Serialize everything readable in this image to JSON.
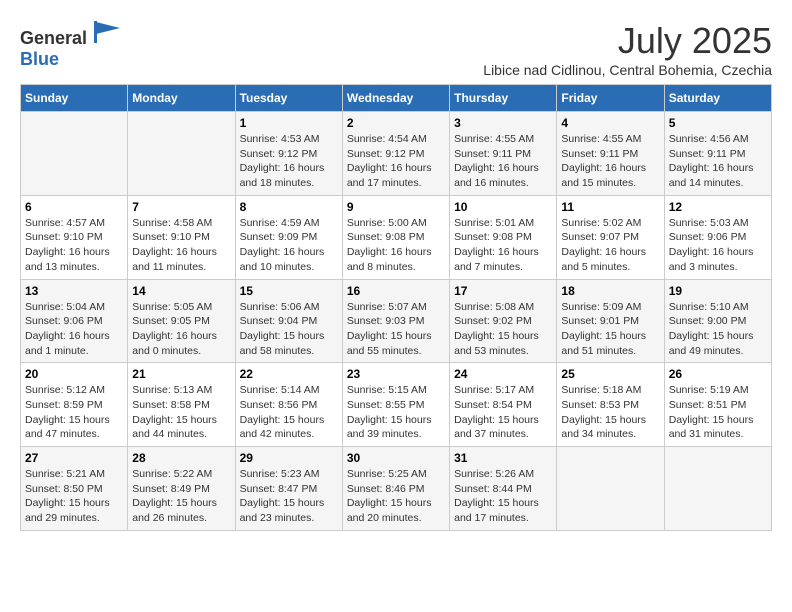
{
  "logo": {
    "general": "General",
    "blue": "Blue"
  },
  "title": "July 2025",
  "location": "Libice nad Cidlinou, Central Bohemia, Czechia",
  "days_of_week": [
    "Sunday",
    "Monday",
    "Tuesday",
    "Wednesday",
    "Thursday",
    "Friday",
    "Saturday"
  ],
  "weeks": [
    [
      {
        "day": "",
        "info": ""
      },
      {
        "day": "",
        "info": ""
      },
      {
        "day": "1",
        "info": "Sunrise: 4:53 AM\nSunset: 9:12 PM\nDaylight: 16 hours and 18 minutes."
      },
      {
        "day": "2",
        "info": "Sunrise: 4:54 AM\nSunset: 9:12 PM\nDaylight: 16 hours and 17 minutes."
      },
      {
        "day": "3",
        "info": "Sunrise: 4:55 AM\nSunset: 9:11 PM\nDaylight: 16 hours and 16 minutes."
      },
      {
        "day": "4",
        "info": "Sunrise: 4:55 AM\nSunset: 9:11 PM\nDaylight: 16 hours and 15 minutes."
      },
      {
        "day": "5",
        "info": "Sunrise: 4:56 AM\nSunset: 9:11 PM\nDaylight: 16 hours and 14 minutes."
      }
    ],
    [
      {
        "day": "6",
        "info": "Sunrise: 4:57 AM\nSunset: 9:10 PM\nDaylight: 16 hours and 13 minutes."
      },
      {
        "day": "7",
        "info": "Sunrise: 4:58 AM\nSunset: 9:10 PM\nDaylight: 16 hours and 11 minutes."
      },
      {
        "day": "8",
        "info": "Sunrise: 4:59 AM\nSunset: 9:09 PM\nDaylight: 16 hours and 10 minutes."
      },
      {
        "day": "9",
        "info": "Sunrise: 5:00 AM\nSunset: 9:08 PM\nDaylight: 16 hours and 8 minutes."
      },
      {
        "day": "10",
        "info": "Sunrise: 5:01 AM\nSunset: 9:08 PM\nDaylight: 16 hours and 7 minutes."
      },
      {
        "day": "11",
        "info": "Sunrise: 5:02 AM\nSunset: 9:07 PM\nDaylight: 16 hours and 5 minutes."
      },
      {
        "day": "12",
        "info": "Sunrise: 5:03 AM\nSunset: 9:06 PM\nDaylight: 16 hours and 3 minutes."
      }
    ],
    [
      {
        "day": "13",
        "info": "Sunrise: 5:04 AM\nSunset: 9:06 PM\nDaylight: 16 hours and 1 minute."
      },
      {
        "day": "14",
        "info": "Sunrise: 5:05 AM\nSunset: 9:05 PM\nDaylight: 16 hours and 0 minutes."
      },
      {
        "day": "15",
        "info": "Sunrise: 5:06 AM\nSunset: 9:04 PM\nDaylight: 15 hours and 58 minutes."
      },
      {
        "day": "16",
        "info": "Sunrise: 5:07 AM\nSunset: 9:03 PM\nDaylight: 15 hours and 55 minutes."
      },
      {
        "day": "17",
        "info": "Sunrise: 5:08 AM\nSunset: 9:02 PM\nDaylight: 15 hours and 53 minutes."
      },
      {
        "day": "18",
        "info": "Sunrise: 5:09 AM\nSunset: 9:01 PM\nDaylight: 15 hours and 51 minutes."
      },
      {
        "day": "19",
        "info": "Sunrise: 5:10 AM\nSunset: 9:00 PM\nDaylight: 15 hours and 49 minutes."
      }
    ],
    [
      {
        "day": "20",
        "info": "Sunrise: 5:12 AM\nSunset: 8:59 PM\nDaylight: 15 hours and 47 minutes."
      },
      {
        "day": "21",
        "info": "Sunrise: 5:13 AM\nSunset: 8:58 PM\nDaylight: 15 hours and 44 minutes."
      },
      {
        "day": "22",
        "info": "Sunrise: 5:14 AM\nSunset: 8:56 PM\nDaylight: 15 hours and 42 minutes."
      },
      {
        "day": "23",
        "info": "Sunrise: 5:15 AM\nSunset: 8:55 PM\nDaylight: 15 hours and 39 minutes."
      },
      {
        "day": "24",
        "info": "Sunrise: 5:17 AM\nSunset: 8:54 PM\nDaylight: 15 hours and 37 minutes."
      },
      {
        "day": "25",
        "info": "Sunrise: 5:18 AM\nSunset: 8:53 PM\nDaylight: 15 hours and 34 minutes."
      },
      {
        "day": "26",
        "info": "Sunrise: 5:19 AM\nSunset: 8:51 PM\nDaylight: 15 hours and 31 minutes."
      }
    ],
    [
      {
        "day": "27",
        "info": "Sunrise: 5:21 AM\nSunset: 8:50 PM\nDaylight: 15 hours and 29 minutes."
      },
      {
        "day": "28",
        "info": "Sunrise: 5:22 AM\nSunset: 8:49 PM\nDaylight: 15 hours and 26 minutes."
      },
      {
        "day": "29",
        "info": "Sunrise: 5:23 AM\nSunset: 8:47 PM\nDaylight: 15 hours and 23 minutes."
      },
      {
        "day": "30",
        "info": "Sunrise: 5:25 AM\nSunset: 8:46 PM\nDaylight: 15 hours and 20 minutes."
      },
      {
        "day": "31",
        "info": "Sunrise: 5:26 AM\nSunset: 8:44 PM\nDaylight: 15 hours and 17 minutes."
      },
      {
        "day": "",
        "info": ""
      },
      {
        "day": "",
        "info": ""
      }
    ]
  ]
}
